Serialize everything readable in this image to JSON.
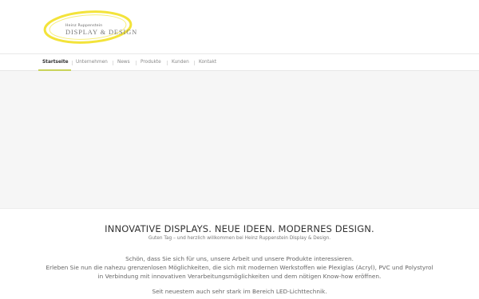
{
  "logo": {
    "small_text": "Heinz Ruppenstein",
    "main_text": "DISPLAY & DESIGN",
    "accent_color": "#f3e33a"
  },
  "nav": {
    "items": [
      {
        "label": "Startseite",
        "active": true
      },
      {
        "label": "Unternehmen",
        "active": false
      },
      {
        "label": "News",
        "active": false
      },
      {
        "label": "Produkte",
        "active": false
      },
      {
        "label": "Kunden",
        "active": false
      },
      {
        "label": "Kontakt",
        "active": false
      }
    ],
    "active_color": "#c9d35a"
  },
  "content": {
    "headline": "INNOVATIVE DISPLAYS. NEUE IDEEN. MODERNES DESIGN.",
    "subline": "Guten Tag – und herzlich willkommen bei Heinz Ruppenstein Display & Design.",
    "para1": "Schön, dass Sie sich für uns, unsere Arbeit und unsere Produkte interessieren.",
    "para2": "Erleben Sie nun die nahezu grenzenlosen Möglichkeiten, die sich mit modernen Werkstoffen wie Plexiglas (Acryl), PVC und Polystyrol",
    "para3": "in Verbindung mit innovativen Verarbeitungsmöglichkeiten und dem nötigen Know-how eröffnen.",
    "para4": "Seit neuestem auch sehr stark im Bereich LED-Lichttechnik."
  }
}
